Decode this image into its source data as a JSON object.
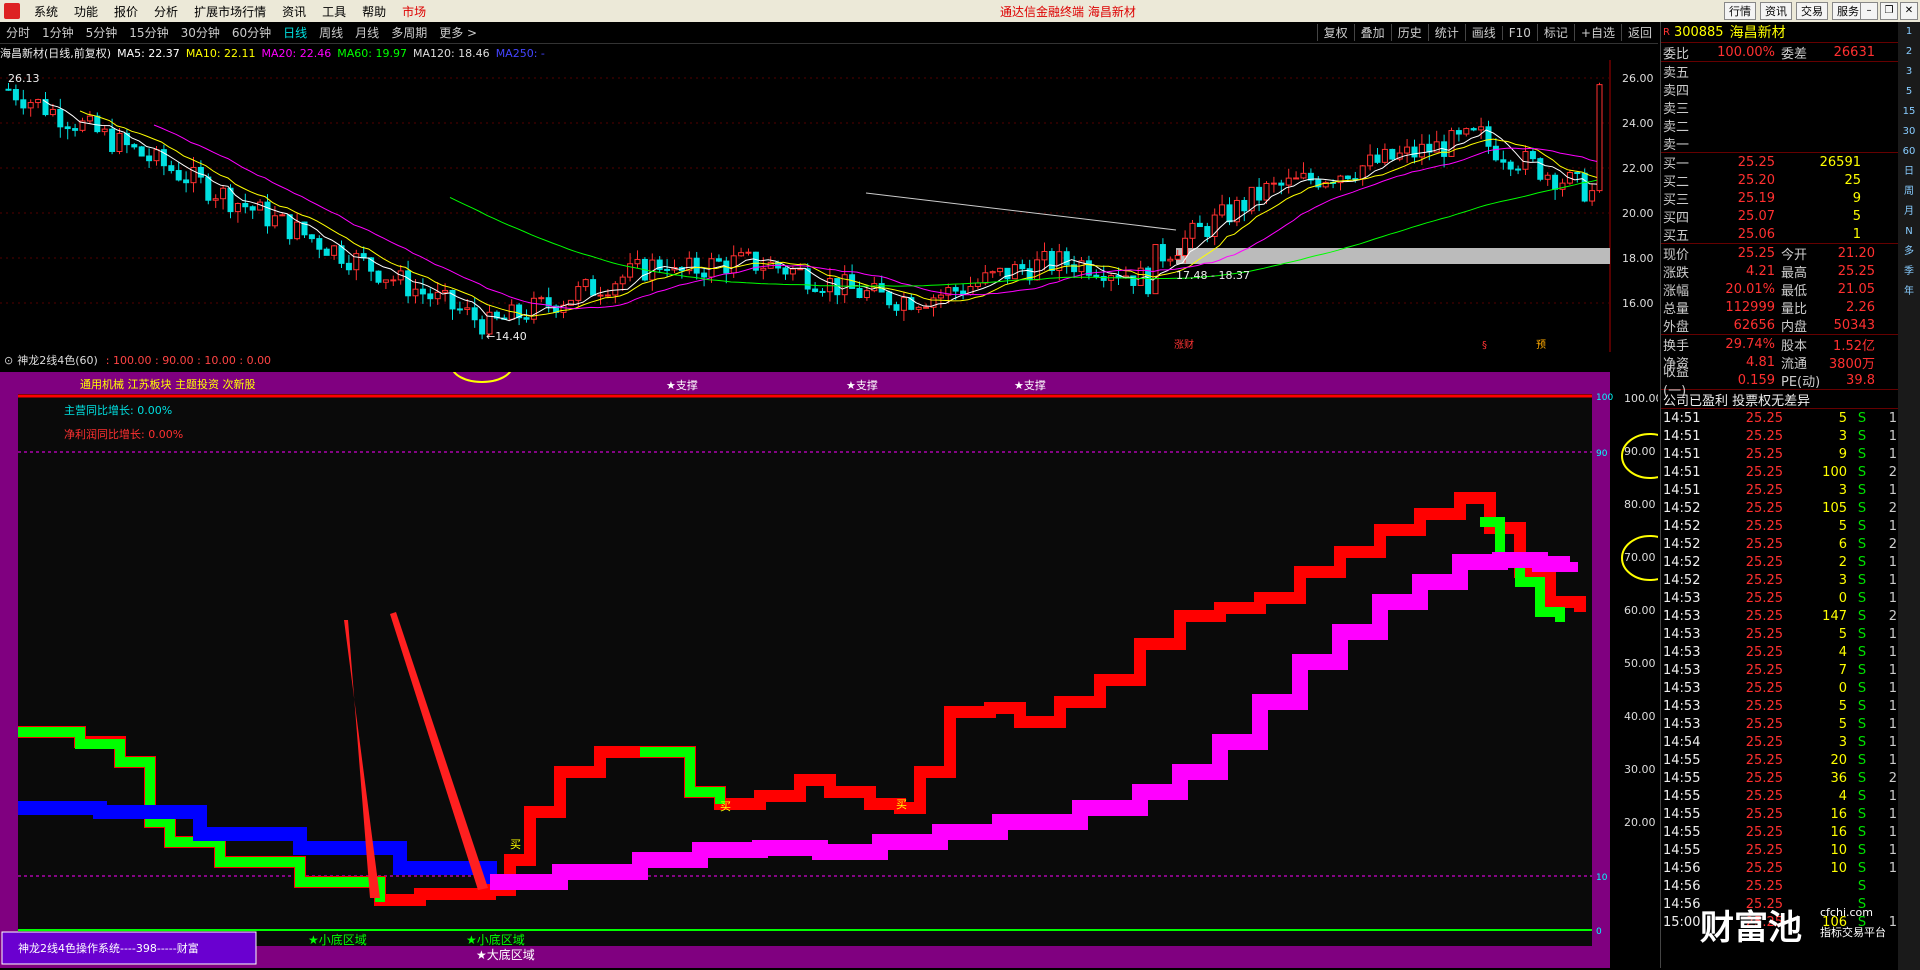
{
  "menu": {
    "items": [
      "系统",
      "功能",
      "报价",
      "分析",
      "扩展市场行情",
      "资讯",
      "工具",
      "帮助",
      "市场"
    ],
    "title": "通达信金融终端  海昌新材",
    "right": [
      "行情",
      "资讯",
      "交易",
      "服务"
    ]
  },
  "periods": [
    "分时",
    "1分钟",
    "5分钟",
    "15分钟",
    "30分钟",
    "60分钟",
    "日线",
    "周线",
    "月线",
    "多周期",
    "更多 >"
  ],
  "toolbar_right": [
    "复权",
    "叠加",
    "历史",
    "统计",
    "画线",
    "F10",
    "标记",
    "+自选",
    "返回"
  ],
  "ma_legend": {
    "name": "海昌新材(日线,前复权)",
    "ma5": "MA5: 22.37",
    "ma10": "MA10: 22.11",
    "ma20": "MA20: 22.46",
    "ma60": "MA60: 19.97",
    "ma120": "MA120: 18.46",
    "ma250": "MA250: -"
  },
  "kchart": {
    "high_label": "26.13",
    "low_label": "←14.40",
    "range_label": "17.48 - 18.37",
    "yticks": [
      "26.00",
      "24.00",
      "22.00",
      "20.00",
      "18.00",
      "16.00"
    ],
    "markers": [
      "涨财",
      "§",
      "预"
    ]
  },
  "indicator": {
    "header": "神龙2线4色(60)",
    "params": ": 100.00 : 90.00 : 10.00 : 0.00",
    "sector": "通用机械 江苏板块 主题投资 次新股",
    "support1": "★支撑",
    "support2": "★支撑",
    "support3": "★支撑",
    "growth1": "主营同比增长: 0.00%",
    "growth2": "净利润同比增长: 0.00%",
    "buy1": "买",
    "buy2": "买",
    "buy3": "买",
    "bottom1": "★小底区域",
    "bottom2": "★小底区域",
    "bottom3": "★大底区域",
    "footer": "神龙2线4色操作系统----398-----财富",
    "yticks": [
      "100.00",
      "90.00",
      "80.00",
      "70.00",
      "60.00",
      "50.00",
      "40.00",
      "30.00",
      "20.00"
    ],
    "right_tags": [
      "100",
      "90",
      "10",
      "0"
    ]
  },
  "quote": {
    "code": "300885",
    "name": "海昌新材",
    "weibi_lbl": "委比",
    "weibi": "100.00%",
    "weicha_lbl": "委差",
    "weicha": "26631",
    "sells": [
      {
        "lbl": "卖五",
        "p": "",
        "v": ""
      },
      {
        "lbl": "卖四",
        "p": "",
        "v": ""
      },
      {
        "lbl": "卖三",
        "p": "",
        "v": ""
      },
      {
        "lbl": "卖二",
        "p": "",
        "v": ""
      },
      {
        "lbl": "卖一",
        "p": "",
        "v": ""
      }
    ],
    "buys": [
      {
        "lbl": "买一",
        "p": "25.25",
        "v": "26591"
      },
      {
        "lbl": "买二",
        "p": "25.20",
        "v": "25"
      },
      {
        "lbl": "买三",
        "p": "25.19",
        "v": "9"
      },
      {
        "lbl": "买四",
        "p": "25.07",
        "v": "5"
      },
      {
        "lbl": "买五",
        "p": "25.06",
        "v": "1"
      }
    ],
    "stats": [
      {
        "l1": "现价",
        "v1": "25.25",
        "l2": "今开",
        "v2": "21.20"
      },
      {
        "l1": "涨跌",
        "v1": "4.21",
        "l2": "最高",
        "v2": "25.25"
      },
      {
        "l1": "涨幅",
        "v1": "20.01%",
        "l2": "最低",
        "v2": "21.05"
      },
      {
        "l1": "总量",
        "v1": "112999",
        "l2": "量比",
        "v2": "2.26"
      },
      {
        "l1": "外盘",
        "v1": "62656",
        "l2": "内盘",
        "v2": "50343"
      }
    ],
    "stats2": [
      {
        "l1": "换手",
        "v1": "29.74%",
        "l2": "股本",
        "v2": "1.52亿"
      },
      {
        "l1": "净资",
        "v1": "4.81",
        "l2": "流通",
        "v2": "3800万"
      },
      {
        "l1": "收益(一)",
        "v1": "0.159",
        "l2": "PE(动)",
        "v2": "39.8"
      }
    ],
    "notice": "公司已盈利 投票权无差异",
    "ticks": [
      [
        "14:51",
        "25.25",
        "5",
        "S",
        "1"
      ],
      [
        "14:51",
        "25.25",
        "3",
        "S",
        "1"
      ],
      [
        "14:51",
        "25.25",
        "9",
        "S",
        "1"
      ],
      [
        "14:51",
        "25.25",
        "100",
        "S",
        "2"
      ],
      [
        "14:51",
        "25.25",
        "3",
        "S",
        "1"
      ],
      [
        "14:52",
        "25.25",
        "105",
        "S",
        "2"
      ],
      [
        "14:52",
        "25.25",
        "5",
        "S",
        "1"
      ],
      [
        "14:52",
        "25.25",
        "6",
        "S",
        "2"
      ],
      [
        "14:52",
        "25.25",
        "2",
        "S",
        "1"
      ],
      [
        "14:52",
        "25.25",
        "3",
        "S",
        "1"
      ],
      [
        "14:53",
        "25.25",
        "0",
        "S",
        "1"
      ],
      [
        "14:53",
        "25.25",
        "147",
        "S",
        "2"
      ],
      [
        "14:53",
        "25.25",
        "5",
        "S",
        "1"
      ],
      [
        "14:53",
        "25.25",
        "4",
        "S",
        "1"
      ],
      [
        "14:53",
        "25.25",
        "7",
        "S",
        "1"
      ],
      [
        "14:53",
        "25.25",
        "0",
        "S",
        "1"
      ],
      [
        "14:53",
        "25.25",
        "5",
        "S",
        "1"
      ],
      [
        "14:53",
        "25.25",
        "5",
        "S",
        "1"
      ],
      [
        "14:54",
        "25.25",
        "3",
        "S",
        "1"
      ],
      [
        "14:55",
        "25.25",
        "20",
        "S",
        "1"
      ],
      [
        "14:55",
        "25.25",
        "36",
        "S",
        "2"
      ],
      [
        "14:55",
        "25.25",
        "4",
        "S",
        "1"
      ],
      [
        "14:55",
        "25.25",
        "16",
        "S",
        "1"
      ],
      [
        "14:55",
        "25.25",
        "16",
        "S",
        "1"
      ],
      [
        "14:55",
        "25.25",
        "10",
        "S",
        "1"
      ],
      [
        "14:56",
        "25.25",
        "10",
        "S",
        "1"
      ],
      [
        "14:56",
        "25.25",
        "",
        "S",
        ""
      ],
      [
        "14:56",
        "25.25",
        "",
        "S",
        ""
      ],
      [
        "15:00",
        "25.25",
        "106",
        "S",
        "1"
      ]
    ]
  },
  "side_icons": [
    "1",
    "2",
    "3",
    "5",
    "15",
    "30",
    "60",
    "日",
    "周",
    "月",
    "N",
    "多",
    "季",
    "年"
  ],
  "watermark": {
    "main": "财富池",
    "url": "cfchi.com",
    "sub": "指标交易平台"
  },
  "colors": {
    "up": "#ff3030",
    "down": "#00e0e0",
    "ind_red": "#ff0000",
    "ind_green": "#00ff00",
    "ind_magenta": "#ff00ff",
    "ind_blue": "#0000ff",
    "panel_border": "#800080"
  }
}
